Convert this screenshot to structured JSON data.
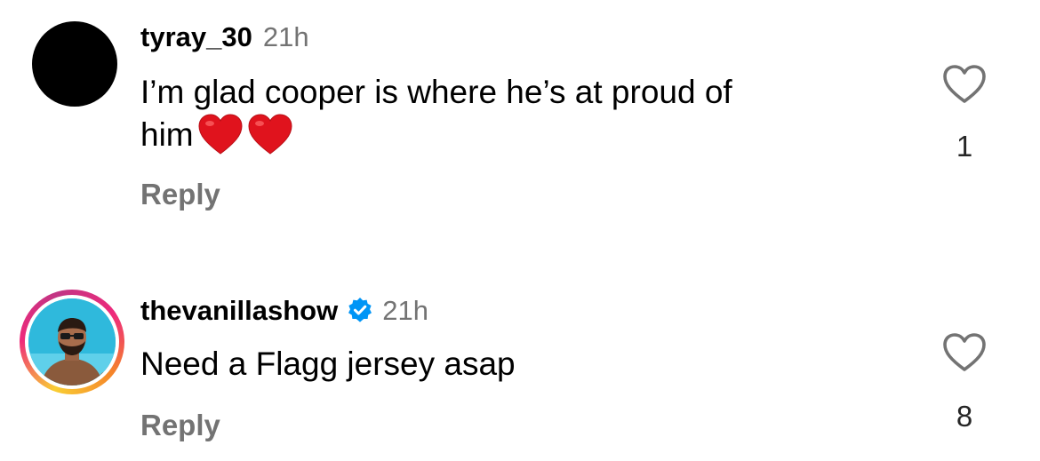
{
  "comments": [
    {
      "username": "tyray_30",
      "time": "21h",
      "verified": false,
      "text": "I’m glad cooper is where he’s at proud of him",
      "text_line1": "I’m glad cooper is where he’s at proud of",
      "text_line2": "him",
      "emoji": "red-heart-emoji x2",
      "reply_label": "Reply",
      "like_count": "1",
      "avatar": "black-circle"
    },
    {
      "username": "thevanillashow",
      "time": "21h",
      "verified": true,
      "text": "Need a Flagg jersey asap",
      "reply_label": "Reply",
      "like_count": "8",
      "avatar": "story-ring-photo"
    }
  ],
  "colors": {
    "secondary_text": "#737373",
    "verified_blue": "#0095f6",
    "heart_red": "#e0131d"
  },
  "icons": {
    "like": "heart-outline-icon",
    "verified": "verified-badge-icon"
  }
}
